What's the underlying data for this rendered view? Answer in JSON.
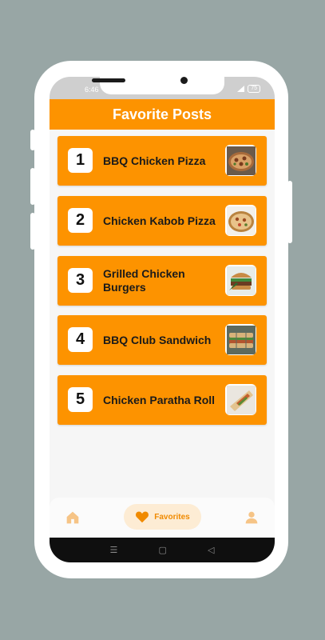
{
  "status": {
    "time": "6:46",
    "battery": "75"
  },
  "appbar": {
    "title": "Favorite Posts"
  },
  "favorites": [
    {
      "number": "1",
      "title": "BBQ Chicken Pizza",
      "thumb_icon": "pizza-thumbnail"
    },
    {
      "number": "2",
      "title": "Chicken Kabob Pizza",
      "thumb_icon": "pizza-thumbnail"
    },
    {
      "number": "3",
      "title": "Grilled Chicken Burgers",
      "thumb_icon": "burger-thumbnail"
    },
    {
      "number": "4",
      "title": "BBQ Club Sandwich",
      "thumb_icon": "sandwich-thumbnail"
    },
    {
      "number": "5",
      "title": "Chicken Paratha Roll",
      "thumb_icon": "roll-thumbnail"
    }
  ],
  "bottom_nav": {
    "home_icon": "home-icon",
    "favorites_label": "Favorites",
    "favorites_icon": "heart-icon",
    "profile_icon": "person-icon",
    "active": "favorites"
  },
  "system_nav": {
    "recents": "☰",
    "home": "▢",
    "back": "◁"
  },
  "colors": {
    "accent": "#fd9300",
    "active_pill": "#fdecd4",
    "background": "#98a6a5"
  }
}
